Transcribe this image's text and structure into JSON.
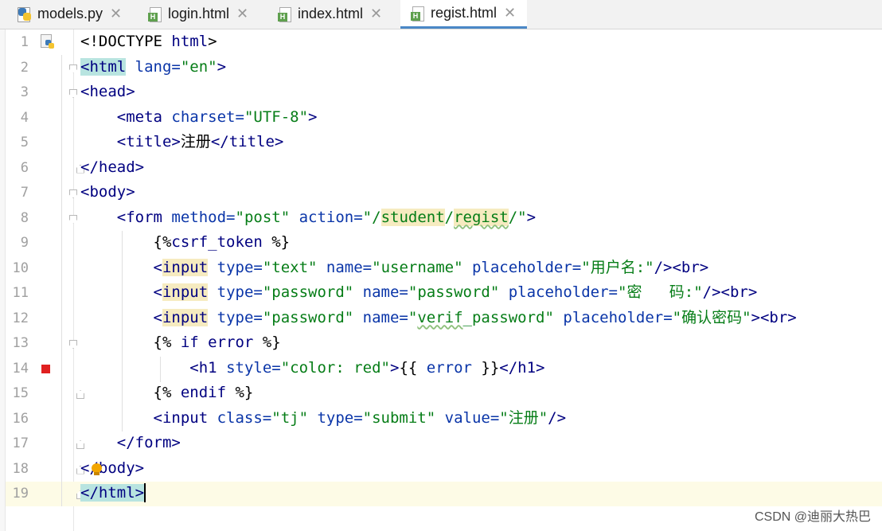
{
  "tabs": [
    {
      "label": "models.py",
      "icon": "python-file-icon",
      "active": false
    },
    {
      "label": "login.html",
      "icon": "html-file-icon",
      "active": false
    },
    {
      "label": "index.html",
      "icon": "html-file-icon",
      "active": false
    },
    {
      "label": "regist.html",
      "icon": "html-file-icon",
      "active": true
    }
  ],
  "close_glyph": "✕",
  "editor": {
    "line_numbers": [
      "1",
      "2",
      "3",
      "4",
      "5",
      "6",
      "7",
      "8",
      "9",
      "10",
      "11",
      "12",
      "13",
      "14",
      "15",
      "16",
      "17",
      "18",
      "19"
    ],
    "current_line": 19,
    "breakpoint_line": 14,
    "code_lines": [
      "<!DOCTYPE html>",
      "<html lang=\"en\">",
      "<head>",
      "    <meta charset=\"UTF-8\">",
      "    <title>注册</title>",
      "</head>",
      "<body>",
      "    <form method=\"post\" action=\"/student/regist/\">",
      "        {%csrf_token %}",
      "        <input type=\"text\" name=\"username\" placeholder=\"用户名:\"/><br>",
      "        <input type=\"password\" name=\"password\" placeholder=\"密   码:\"/><br>",
      "        <input type=\"password\" name=\"verif_password\" placeholder=\"确认密码\"><br>",
      "        {% if error %}",
      "            <h1 style=\"color: red\">{{ error }}</h1>",
      "        {% endif %}",
      "        <input class=\"tj\" type=\"submit\" value=\"注册\"/>",
      "    </form>",
      "</body>",
      "</html>"
    ]
  },
  "watermark": "CSDN @迪丽大热巴",
  "colors": {
    "tag": "#000080",
    "attribute": "#0a35a8",
    "string": "#067d17",
    "breakpoint": "#e02020",
    "tab_active_underline": "#4a88c7"
  }
}
